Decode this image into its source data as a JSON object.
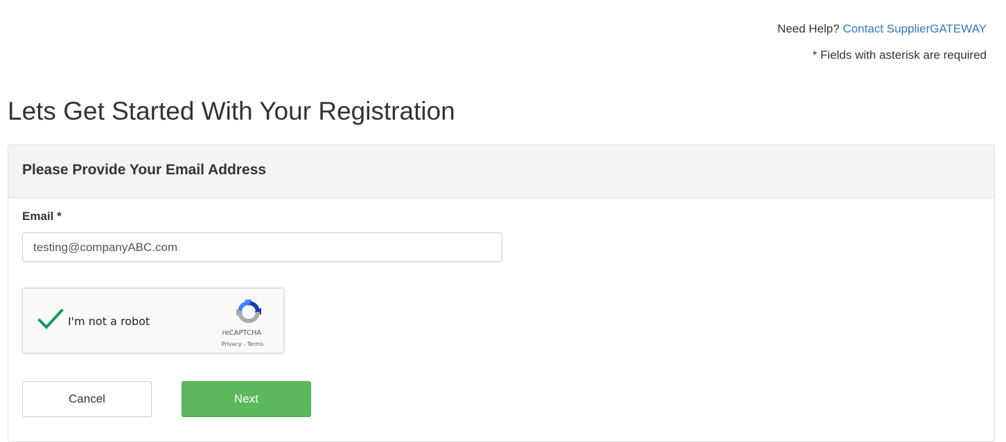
{
  "header": {
    "help_prefix": "Need Help?",
    "help_link": "Contact SupplierGATEWAY",
    "required_note": "* Fields with asterisk are required"
  },
  "page": {
    "title": "Lets Get Started With Your Registration"
  },
  "panel": {
    "title": "Please Provide Your Email Address",
    "email_label": "Email *",
    "email_value": "testing@companyABC.com"
  },
  "captcha": {
    "label": "I'm not a robot",
    "checked": true,
    "brand": "reCAPTCHA",
    "privacy": "Privacy",
    "separator": " - ",
    "terms": "Terms",
    "check_color": "#0f9d58"
  },
  "buttons": {
    "cancel": "Cancel",
    "next": "Next"
  },
  "colors": {
    "link": "#337ab7",
    "primary_button": "#5cb85c",
    "panel_heading_bg": "#f4f4f4"
  }
}
